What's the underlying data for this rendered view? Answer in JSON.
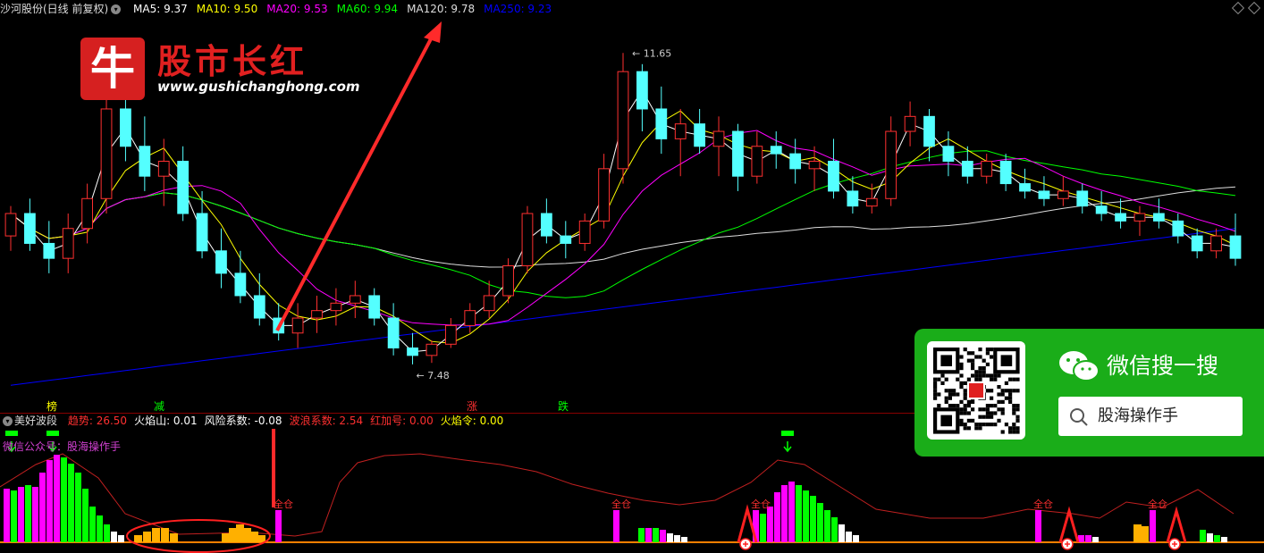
{
  "header": {
    "stock_name": "沙河股份(日线 前复权)",
    "ma_items": [
      {
        "label": "MA5: 9.37",
        "color": "#ffffff"
      },
      {
        "label": "MA10: 9.50",
        "color": "#ffff00"
      },
      {
        "label": "MA20: 9.53",
        "color": "#ff00ff"
      },
      {
        "label": "MA60: 9.94",
        "color": "#00ff00"
      },
      {
        "label": "MA120: 9.78",
        "color": "#dddddd"
      },
      {
        "label": "MA250: 9.23",
        "color": "#0000ff"
      }
    ]
  },
  "indicator": {
    "name": "美好波段",
    "items": [
      {
        "label": "趋势: ",
        "value": "26.50",
        "label_color": "#ff3030",
        "value_color": "#ff3030"
      },
      {
        "label": "火焰山: ",
        "value": "0.01",
        "label_color": "#ffffff",
        "value_color": "#ffffff"
      },
      {
        "label": "风险系数: ",
        "value": "-0.08",
        "label_color": "#ffffff",
        "value_color": "#ffffff"
      },
      {
        "label": "波浪系数: ",
        "value": "2.54",
        "label_color": "#ff3030",
        "value_color": "#ff3030"
      },
      {
        "label": "红加号: ",
        "value": "0.00",
        "label_color": "#ff3030",
        "value_color": "#ff3030"
      },
      {
        "label": "火焰令: ",
        "value": "0.00",
        "label_color": "#ffff00",
        "value_color": "#ffff00"
      }
    ],
    "wechat_note": "微信公众号：股海操作手",
    "full_position_label": "全仓"
  },
  "price_annotations": {
    "high": "11.65",
    "low": "7.48"
  },
  "calendar_labels": [
    {
      "text": "榜",
      "color": "#ffff00"
    },
    {
      "text": "减",
      "color": "#00ff00"
    },
    {
      "text": "涨",
      "color": "#ff3030"
    },
    {
      "text": "跌",
      "color": "#00ff00"
    }
  ],
  "logo": {
    "glyph": "牛",
    "title": "股市长红",
    "url": "www.gushichanghong.com"
  },
  "wechat_card": {
    "title": "微信搜一搜",
    "search_text": "股海操作手",
    "search_icon": "search-icon",
    "wechat_icon": "wechat-icon"
  },
  "colors": {
    "up": "#ff3030",
    "down": "#54ffff",
    "ma5": "#ffffff",
    "ma10": "#ffff00",
    "ma20": "#ff00ff",
    "ma60": "#00ff00",
    "ma120": "#dddddd",
    "ma250": "#0000ff",
    "wechat_green": "#1aad19"
  },
  "chart_data": {
    "type": "candlestick",
    "title": "沙河股份(日线 前复权)",
    "ylim": [
      7.0,
      12.0
    ],
    "marked_high": 11.65,
    "marked_low": 7.48,
    "candles": [
      [
        9.2,
        9.6,
        9.0,
        9.5
      ],
      [
        9.5,
        9.7,
        9.0,
        9.1
      ],
      [
        9.1,
        9.4,
        8.7,
        8.9
      ],
      [
        8.9,
        9.5,
        8.7,
        9.3
      ],
      [
        9.3,
        9.9,
        9.1,
        9.7
      ],
      [
        9.7,
        11.2,
        9.5,
        10.9
      ],
      [
        10.9,
        11.1,
        10.2,
        10.4
      ],
      [
        10.4,
        10.8,
        9.8,
        10.0
      ],
      [
        10.0,
        10.5,
        9.6,
        10.2
      ],
      [
        10.2,
        10.4,
        9.4,
        9.5
      ],
      [
        9.5,
        9.8,
        8.9,
        9.0
      ],
      [
        9.0,
        9.3,
        8.5,
        8.7
      ],
      [
        8.7,
        9.0,
        8.3,
        8.4
      ],
      [
        8.4,
        8.7,
        8.0,
        8.1
      ],
      [
        8.1,
        8.3,
        7.8,
        7.9
      ],
      [
        7.9,
        8.3,
        7.7,
        8.1
      ],
      [
        8.1,
        8.4,
        7.9,
        8.2
      ],
      [
        8.2,
        8.5,
        8.0,
        8.3
      ],
      [
        8.3,
        8.6,
        8.1,
        8.4
      ],
      [
        8.4,
        8.5,
        8.0,
        8.1
      ],
      [
        8.1,
        8.3,
        7.6,
        7.7
      ],
      [
        7.7,
        7.9,
        7.48,
        7.6
      ],
      [
        7.6,
        7.8,
        7.5,
        7.75
      ],
      [
        7.75,
        8.1,
        7.7,
        8.0
      ],
      [
        8.0,
        8.3,
        7.9,
        8.2
      ],
      [
        8.2,
        8.6,
        8.1,
        8.4
      ],
      [
        8.4,
        8.9,
        8.3,
        8.8
      ],
      [
        8.8,
        9.6,
        8.7,
        9.5
      ],
      [
        9.5,
        9.7,
        9.1,
        9.2
      ],
      [
        9.2,
        9.4,
        8.9,
        9.1
      ],
      [
        9.1,
        9.5,
        9.0,
        9.4
      ],
      [
        9.4,
        10.3,
        9.3,
        10.1
      ],
      [
        10.1,
        11.65,
        9.9,
        11.4
      ],
      [
        11.4,
        11.5,
        10.6,
        10.9
      ],
      [
        10.9,
        11.2,
        10.3,
        10.5
      ],
      [
        10.5,
        10.9,
        10.0,
        10.7
      ],
      [
        10.7,
        10.9,
        10.3,
        10.4
      ],
      [
        10.4,
        10.8,
        10.0,
        10.6
      ],
      [
        10.6,
        10.7,
        9.8,
        10.0
      ],
      [
        10.0,
        10.6,
        9.9,
        10.4
      ],
      [
        10.4,
        10.6,
        10.1,
        10.3
      ],
      [
        10.3,
        10.5,
        9.9,
        10.1
      ],
      [
        10.1,
        10.4,
        9.8,
        10.2
      ],
      [
        10.2,
        10.5,
        9.7,
        9.8
      ],
      [
        9.8,
        10.0,
        9.5,
        9.6
      ],
      [
        9.6,
        9.9,
        9.5,
        9.7
      ],
      [
        9.7,
        10.8,
        9.6,
        10.6
      ],
      [
        10.6,
        11.0,
        10.4,
        10.8
      ],
      [
        10.8,
        10.9,
        10.2,
        10.4
      ],
      [
        10.4,
        10.6,
        10.0,
        10.2
      ],
      [
        10.2,
        10.4,
        9.9,
        10.0
      ],
      [
        10.0,
        10.3,
        9.9,
        10.2
      ],
      [
        10.2,
        10.3,
        9.8,
        9.9
      ],
      [
        9.9,
        10.1,
        9.7,
        9.8
      ],
      [
        9.8,
        10.0,
        9.6,
        9.7
      ],
      [
        9.7,
        10.0,
        9.6,
        9.8
      ],
      [
        9.8,
        9.9,
        9.5,
        9.6
      ],
      [
        9.6,
        9.8,
        9.4,
        9.5
      ],
      [
        9.5,
        9.7,
        9.3,
        9.4
      ],
      [
        9.4,
        9.6,
        9.2,
        9.5
      ],
      [
        9.5,
        9.7,
        9.3,
        9.4
      ],
      [
        9.4,
        9.5,
        9.1,
        9.2
      ],
      [
        9.2,
        9.3,
        8.9,
        9.0
      ],
      [
        9.0,
        9.3,
        8.9,
        9.2
      ],
      [
        9.2,
        9.5,
        8.8,
        8.9
      ]
    ]
  }
}
